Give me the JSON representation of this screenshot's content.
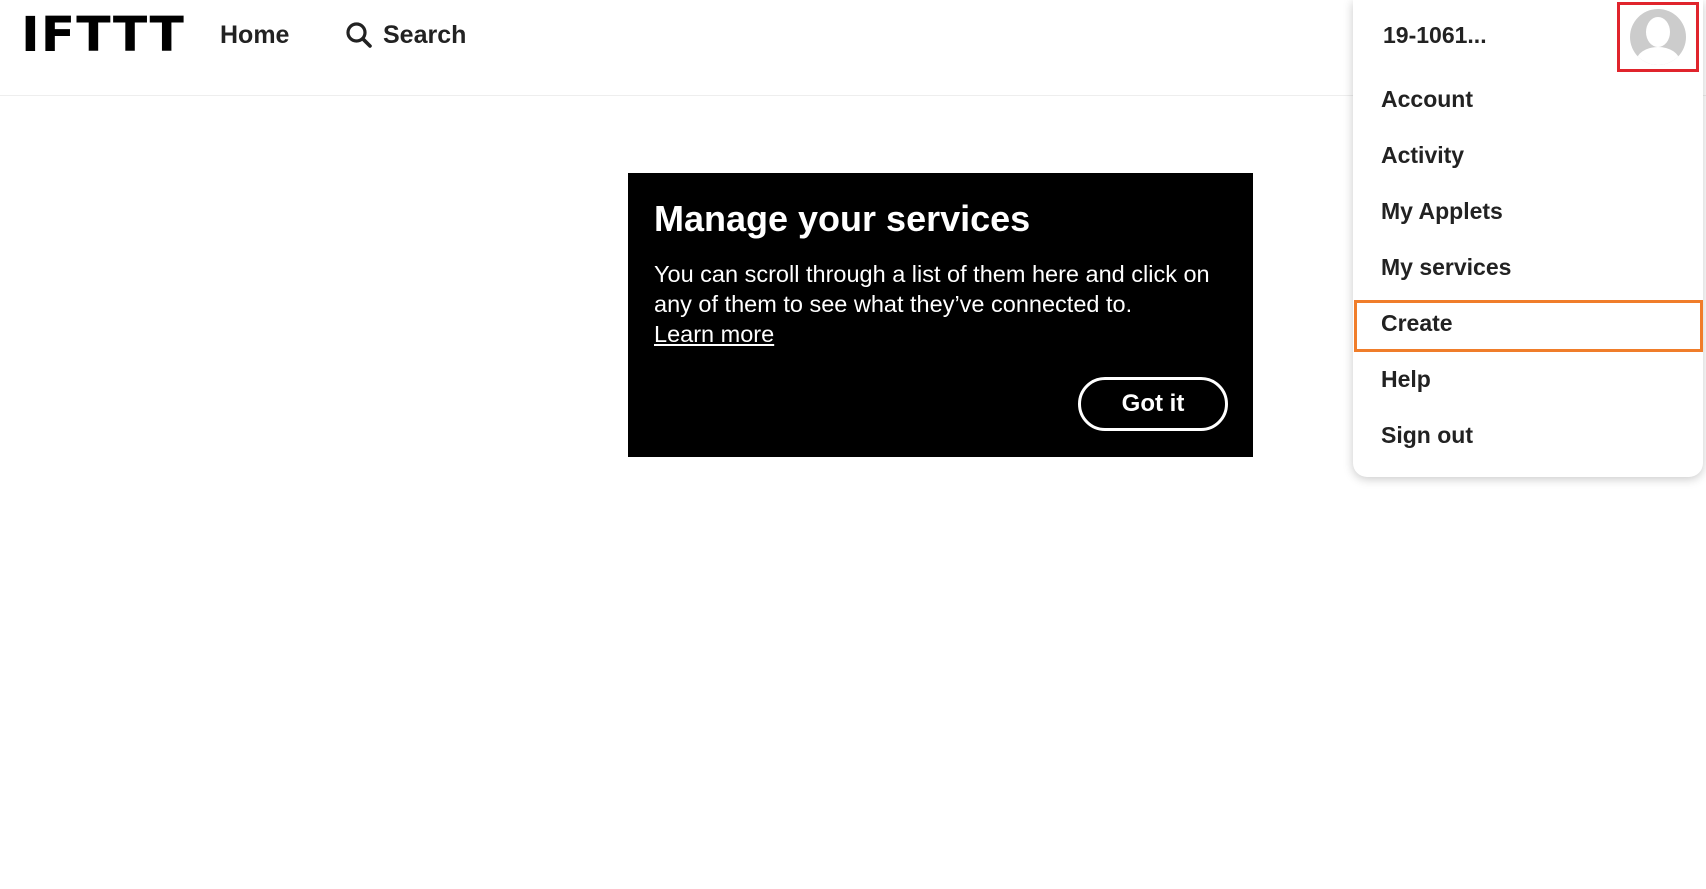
{
  "header": {
    "logo": "IFTTT",
    "home_label": "Home",
    "search_label": "Search",
    "search_icon": "search-icon"
  },
  "tip": {
    "title": "Manage your services",
    "body": "You can scroll through a list of them here and click on any of them to see what they’ve connected to.",
    "link_label": "Learn more",
    "button_label": "Got it"
  },
  "account_menu": {
    "username": "19-1061...",
    "avatar_icon": "avatar-icon",
    "highlight_color_avatar": "#e0242c",
    "highlight_color_item": "#f07d2a",
    "items": [
      {
        "label": "Account"
      },
      {
        "label": "Activity"
      },
      {
        "label": "My Applets"
      },
      {
        "label": "My services"
      },
      {
        "label": "Create"
      },
      {
        "label": "Help"
      },
      {
        "label": "Sign out"
      }
    ]
  }
}
